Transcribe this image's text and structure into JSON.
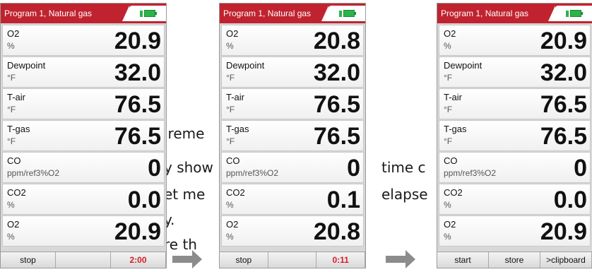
{
  "background_text": [
    "ireme",
    "y show",
    "time c",
    "et me",
    "elapse",
    "y.",
    "re th"
  ],
  "screens": [
    {
      "title": "Program 1, Natural gas",
      "rows": [
        {
          "name": "O2",
          "unit": "%",
          "value": "20.9"
        },
        {
          "name": "Dewpoint",
          "unit": "°F",
          "value": "32.0"
        },
        {
          "name": "T-air",
          "unit": "°F",
          "value": "76.5"
        },
        {
          "name": "T-gas",
          "unit": "°F",
          "value": "76.5"
        },
        {
          "name": "CO",
          "unit": "ppm/ref3%O2",
          "value": "0"
        },
        {
          "name": "CO2",
          "unit": "%",
          "value": "0.0"
        },
        {
          "name": "O2",
          "unit": "%",
          "value": "20.9"
        }
      ],
      "softkeys": [
        "stop",
        "",
        "2:00"
      ]
    },
    {
      "title": "Program 1, Natural gas",
      "rows": [
        {
          "name": "O2",
          "unit": "%",
          "value": "20.8"
        },
        {
          "name": "Dewpoint",
          "unit": "°F",
          "value": "32.0"
        },
        {
          "name": "T-air",
          "unit": "°F",
          "value": "76.5"
        },
        {
          "name": "T-gas",
          "unit": "°F",
          "value": "76.5"
        },
        {
          "name": "CO",
          "unit": "ppm/ref3%O2",
          "value": "0"
        },
        {
          "name": "CO2",
          "unit": "%",
          "value": "0.1"
        },
        {
          "name": "O2",
          "unit": "%",
          "value": "20.8"
        }
      ],
      "softkeys": [
        "stop",
        "",
        "0:11"
      ]
    },
    {
      "title": "Program 1, Natural gas",
      "rows": [
        {
          "name": "O2",
          "unit": "%",
          "value": "20.9"
        },
        {
          "name": "Dewpoint",
          "unit": "°F",
          "value": "32.0"
        },
        {
          "name": "T-air",
          "unit": "°F",
          "value": "76.5"
        },
        {
          "name": "T-gas",
          "unit": "°F",
          "value": "76.5"
        },
        {
          "name": "CO",
          "unit": "ppm/ref3%O2",
          "value": "0"
        },
        {
          "name": "CO2",
          "unit": "%",
          "value": "0.0"
        },
        {
          "name": "O2",
          "unit": "%",
          "value": "20.9"
        }
      ],
      "softkeys": [
        "start",
        "store",
        ">clipboard"
      ]
    }
  ],
  "colors": {
    "title_bar": "#c0232f",
    "timer_text": "#d4202a",
    "battery": "#2bb44a"
  },
  "icons": [
    "battery-icon",
    "arrow-right-icon"
  ]
}
